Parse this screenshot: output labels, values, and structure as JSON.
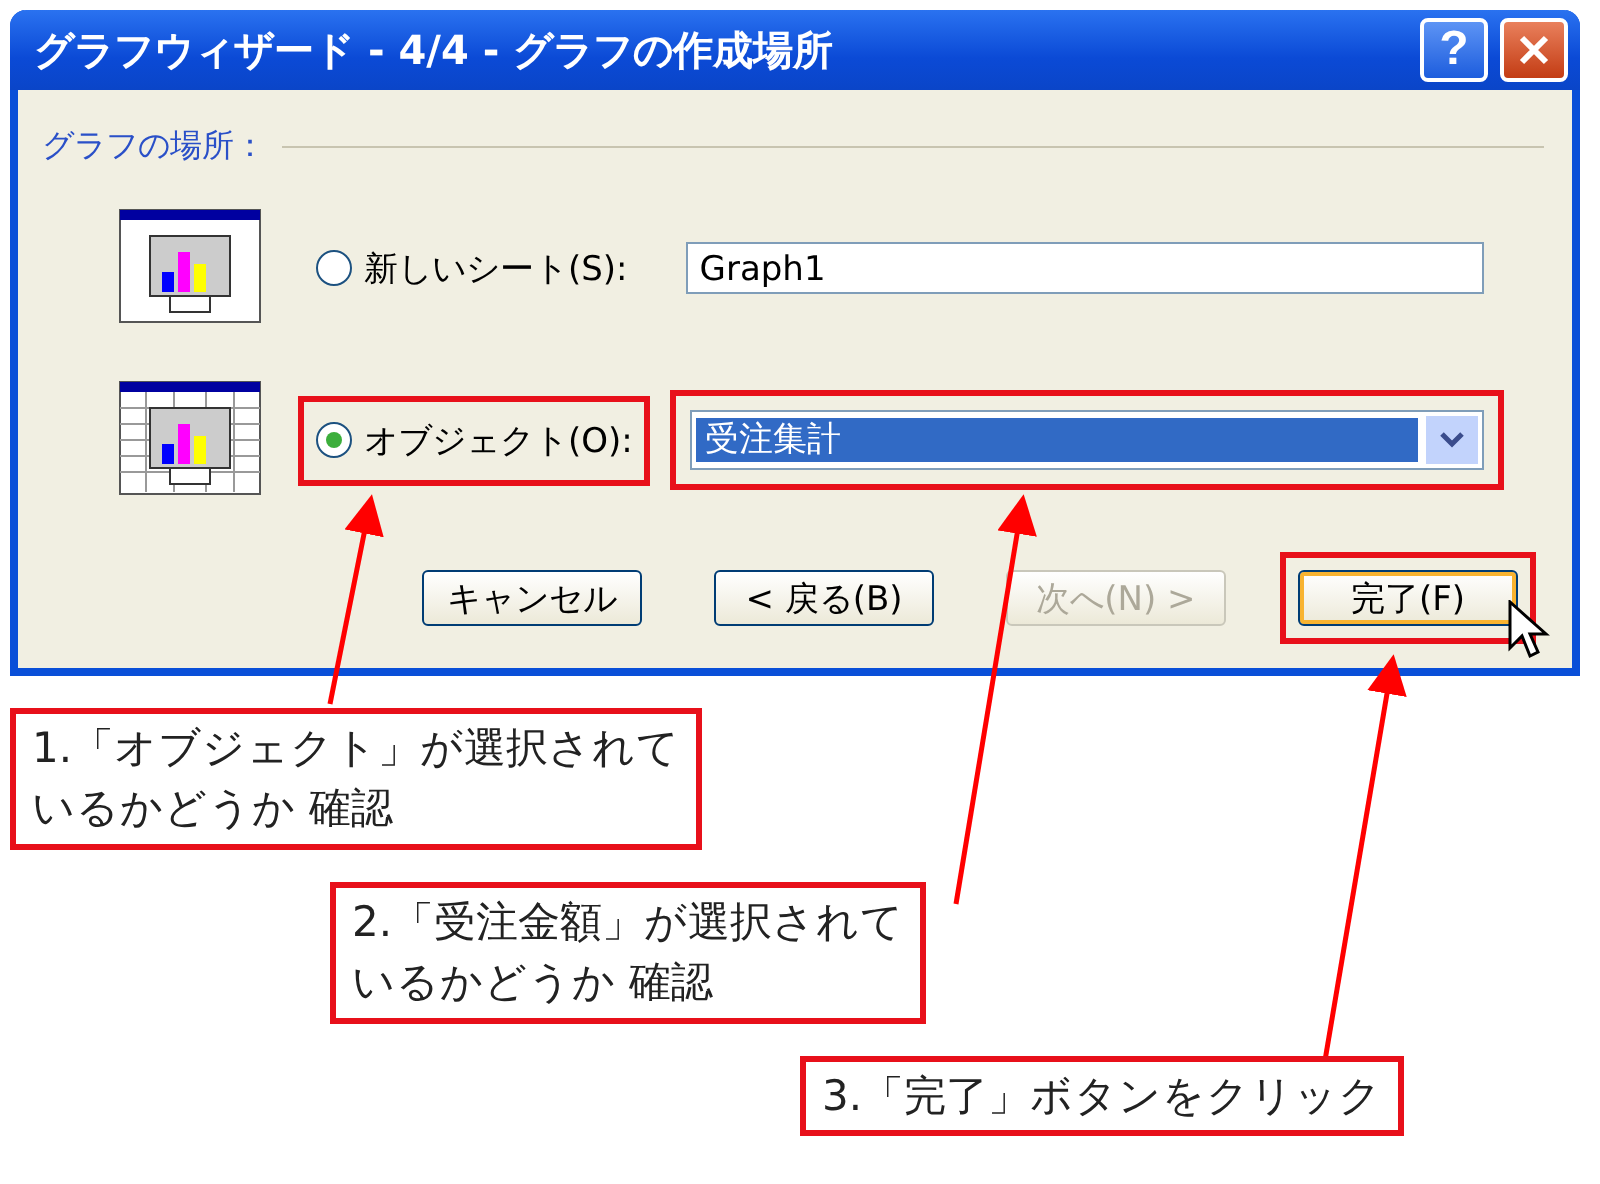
{
  "window": {
    "title": "グラフウィザード - 4/4 - グラフの作成場所",
    "help": "?"
  },
  "group_label": "グラフの場所：",
  "options": [
    {
      "kind": "text",
      "label": "新しいシート(S):",
      "selected": false,
      "highlighted": false,
      "value": "Graph1"
    },
    {
      "kind": "combo",
      "label": "オブジェクト(O):",
      "selected": true,
      "highlighted": true,
      "value": "受注集計"
    }
  ],
  "buttons": [
    {
      "label": "キャンセル",
      "disabled": false,
      "default": false,
      "highlighted": false
    },
    {
      "label": "< 戻る(B)",
      "disabled": false,
      "default": false,
      "highlighted": false
    },
    {
      "label": "次へ(N) >",
      "disabled": true,
      "default": false,
      "highlighted": false
    },
    {
      "label": "完了(F)",
      "disabled": false,
      "default": true,
      "highlighted": true
    }
  ],
  "callouts": [
    {
      "lines": [
        "1.「オブジェクト」が選択されて",
        "いるかどうか 確認"
      ]
    },
    {
      "lines": [
        "2.「受注金額」が選択されて",
        "いるかどうか 確認"
      ]
    },
    {
      "lines": [
        "3.「完了」ボタンをクリック"
      ]
    }
  ]
}
